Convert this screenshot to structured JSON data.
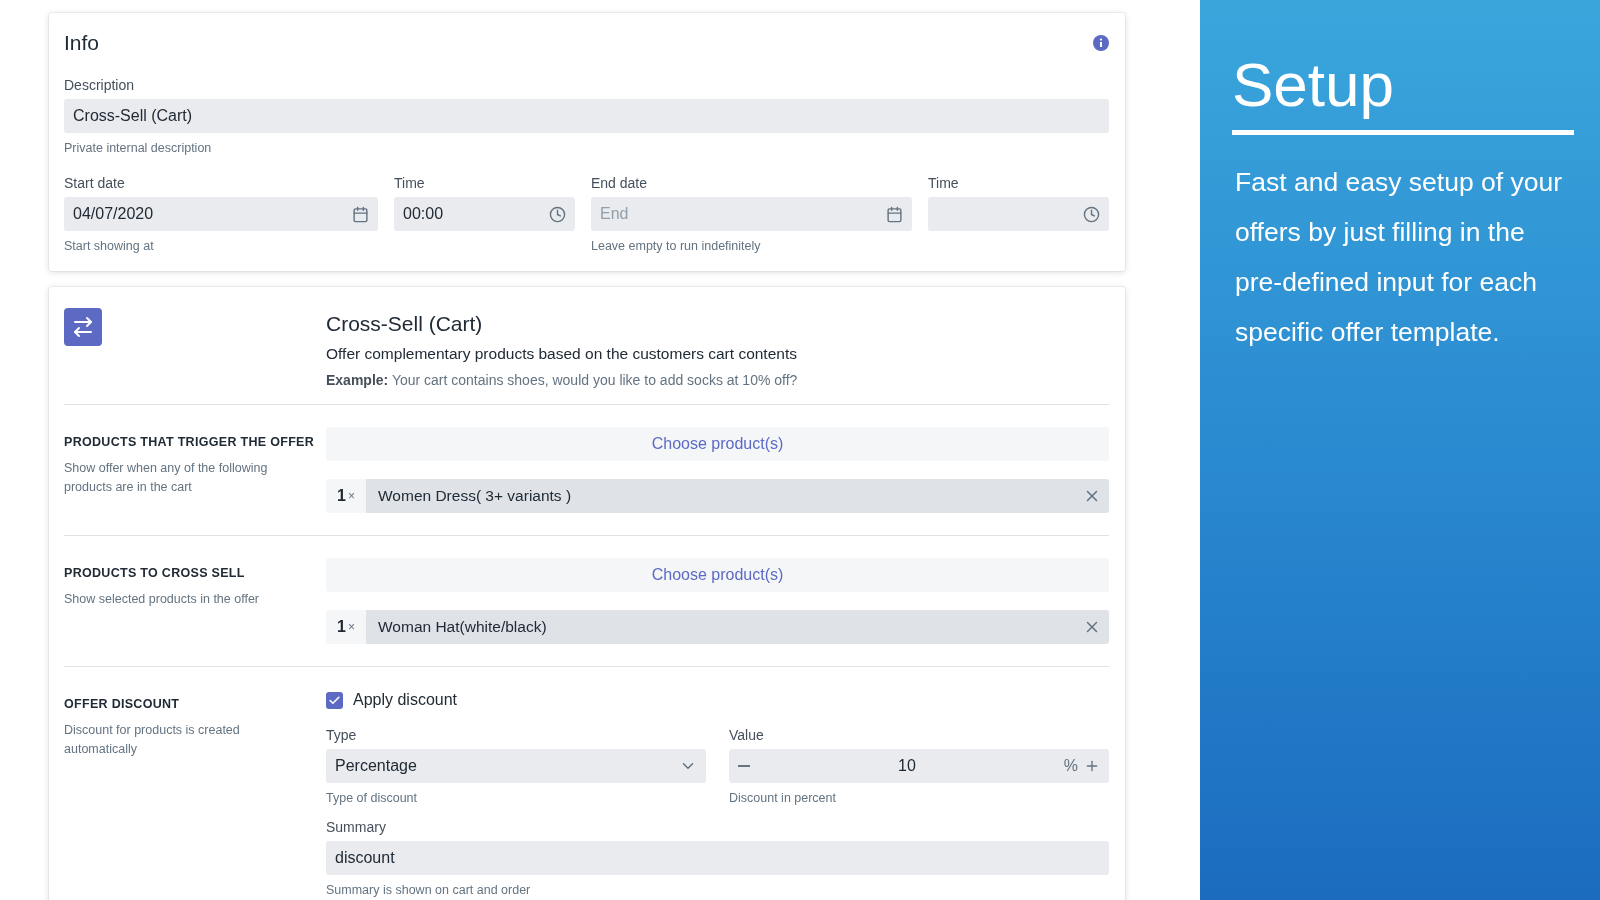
{
  "info": {
    "title": "Info",
    "description": {
      "label": "Description",
      "value": "Cross-Sell (Cart)",
      "hint": "Private internal description"
    },
    "schedule": [
      {
        "kind": "date",
        "label": "Start date",
        "value": "04/07/2020",
        "hint": "Start showing at"
      },
      {
        "kind": "time",
        "label": "Time",
        "value": "00:00"
      },
      {
        "kind": "date",
        "label": "End date",
        "placeholder": "End",
        "hint": "Leave empty to run indefinitely"
      },
      {
        "kind": "time",
        "label": "Time"
      }
    ]
  },
  "offer": {
    "title": "Cross-Sell (Cart)",
    "subtitle": "Offer complementary products based on the customers cart contents",
    "example": "**Example:** Your cart contains shoes, would you like to add socks at 10% off?",
    "sections": [
      {
        "kind": "products",
        "heading": "PRODUCTS THAT TRIGGER THE OFFER",
        "note": "Show offer when any of the following products are in the cart",
        "button": "Choose product(s)",
        "items": [
          {
            "quantity": "1",
            "times": "×",
            "name": "Women Dress( 3+ variants )"
          }
        ]
      },
      {
        "kind": "products",
        "heading": "PRODUCTS TO CROSS SELL",
        "note": "Show selected products in the offer",
        "button": "Choose product(s)",
        "items": [
          {
            "quantity": "1",
            "times": "×",
            "name": "Woman Hat(white/black)"
          }
        ]
      },
      {
        "kind": "discount",
        "heading": "OFFER DISCOUNT",
        "note": "Discount for products is created automatically",
        "apply": {
          "label": "Apply discount",
          "checked": true
        },
        "type": {
          "label": "Type",
          "value": "Percentage",
          "hint": "Type of discount"
        },
        "value": {
          "label": "Value",
          "value": "10",
          "unit": "%",
          "hint": "Discount in percent"
        },
        "summary": {
          "label": "Summary",
          "value": "discount",
          "hint": "Summary is shown on cart and order"
        }
      }
    ]
  },
  "promo": {
    "title": "Setup",
    "text": "Fast and easy setup of your offers by just filling in the pre-defined input for each specific offer template."
  }
}
